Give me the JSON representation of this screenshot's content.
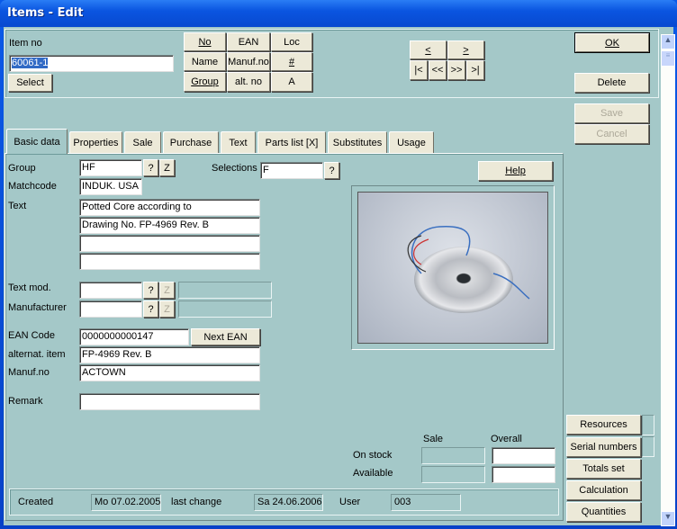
{
  "window": {
    "title": "Items  - Edit"
  },
  "search": {
    "item_no_label": "Item no",
    "item_no_value": "60061-1",
    "select_label": "Select",
    "sort_buttons": [
      "No",
      "EAN",
      "Loc",
      "Name",
      "Manuf.no",
      "#",
      "Group",
      "alt. no",
      "A"
    ]
  },
  "nav": {
    "prev": "<",
    "next": ">",
    "first": "|<",
    "back": "<<",
    "forward": ">>",
    "last": ">|"
  },
  "actions": {
    "ok": "OK",
    "delete": "Delete",
    "save": "Save",
    "cancel": "Cancel"
  },
  "tabs": [
    {
      "label": "Basic data",
      "selected": true
    },
    {
      "label": "Properties"
    },
    {
      "label": "Sale"
    },
    {
      "label": "Purchase"
    },
    {
      "label": "Text"
    },
    {
      "label": "Parts list  [X]"
    },
    {
      "label": "Substitutes"
    },
    {
      "label": "Usage"
    }
  ],
  "form": {
    "group_label": "Group",
    "group_value": "HF",
    "q": "?",
    "z": "Z",
    "selections_label": "Selections",
    "selections_value": "F",
    "matchcode_label": "Matchcode",
    "matchcode_value": "INDUK. USA",
    "text_label": "Text",
    "text_lines": [
      "Potted Core according to",
      "Drawing No. FP-4969 Rev. B",
      "",
      ""
    ],
    "textmod_label": "Text mod.",
    "textmod_value": "",
    "manufacturer_label": "Manufacturer",
    "manufacturer_value": "",
    "ean_label": "EAN Code",
    "ean_value": "0000000000147",
    "next_ean": "Next EAN",
    "alt_label": "alternat. item",
    "alt_value": "FP-4969 Rev. B",
    "manufno_label": "Manuf.no",
    "manufno_value": "ACTOWN",
    "remark_label": "Remark",
    "remark_value": "",
    "help": "Help"
  },
  "stock": {
    "sale_header": "Sale",
    "overall_header": "Overall",
    "on_stock_label": "On stock",
    "available_label": "Available",
    "on_stock_sale": "",
    "on_stock_overall": "",
    "available_sale": "",
    "available_overall": ""
  },
  "status": {
    "created_label": "Created",
    "created_value": "Mo 07.02.2005",
    "changed_label": "last change",
    "changed_value": "Sa 24.06.2006",
    "user_label": "User",
    "user_value": "003"
  },
  "side_buttons": [
    "Resources",
    "Serial numbers",
    "Totals set",
    "Calculation",
    "Quantities"
  ]
}
